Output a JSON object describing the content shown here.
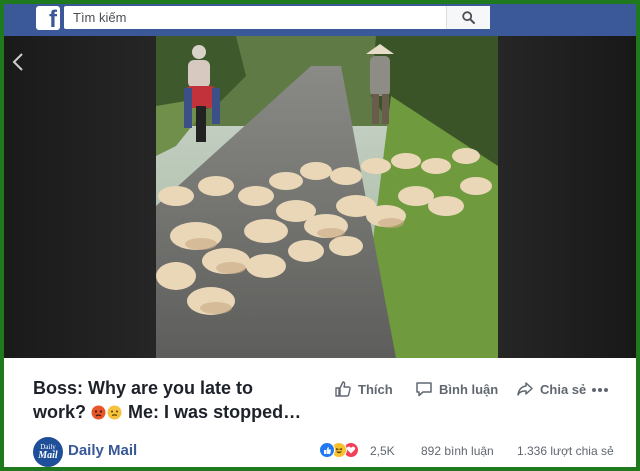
{
  "header": {
    "logo": "f",
    "search": {
      "placeholder": "Tìm kiếm",
      "value": ""
    },
    "search_icon": "search-icon"
  },
  "video": {
    "prev_icon": "chevron-left-icon",
    "content": "ducks-on-road-video"
  },
  "post": {
    "title_line1": "Boss: Why are you late to",
    "title_line2_pre": "work?",
    "title_line2_post": "Me: I was stopped…",
    "emojis": [
      "angry-face-emoji",
      "steaming-face-emoji"
    ]
  },
  "actions": {
    "like": "Thích",
    "comment": "Bình luận",
    "share": "Chia sẻ",
    "more_icon": "more-dots-icon"
  },
  "page": {
    "avatar_line1": "Daily",
    "avatar_line2": "Mail",
    "name": "Daily Mail"
  },
  "stats": {
    "reaction_icons": [
      "like-reaction-icon",
      "haha-reaction-icon",
      "love-reaction-icon"
    ],
    "reactions": "2,5K",
    "comments": "892 bình luận",
    "shares": "1.336 lượt chia sẻ"
  },
  "colors": {
    "facebook_blue": "#3b5998",
    "link_blue": "#385898",
    "border_green": "#1f7a1f"
  }
}
